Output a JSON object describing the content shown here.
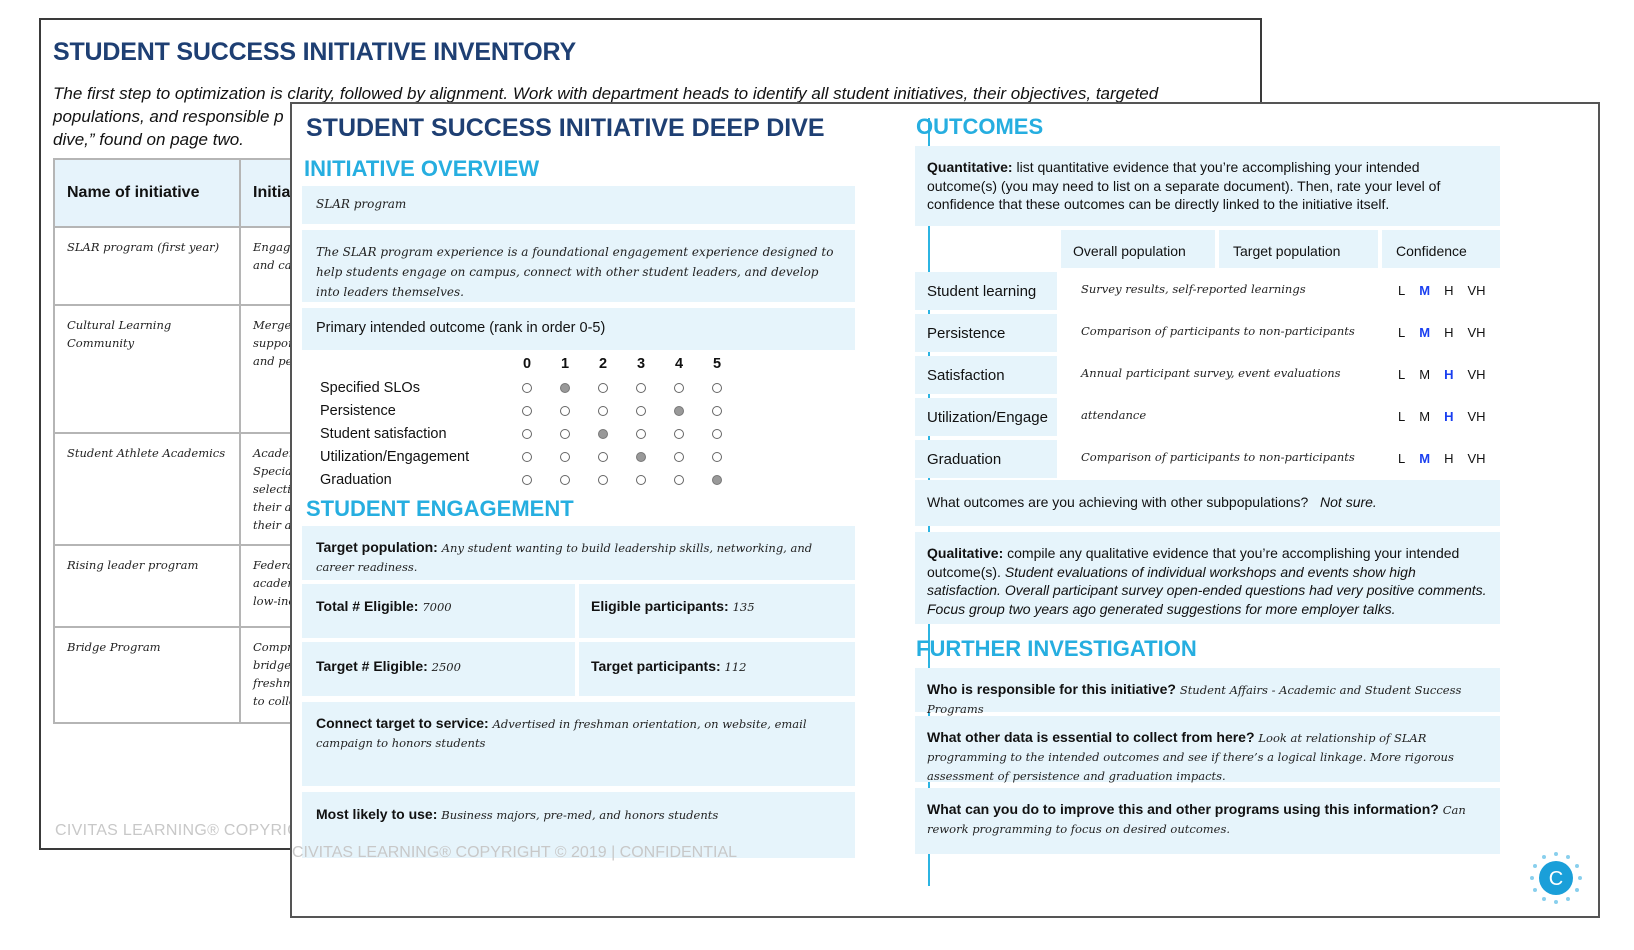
{
  "inventory": {
    "title": "STUDENT SUCCESS INITIATIVE INVENTORY",
    "intro": "The first step to optimization is clarity, followed by alignment. Work with department heads to identify all student initiatives, their objectives, targeted populations, and responsible p... dive,” found on page two.",
    "intro_line1": "The first step to optimization is clarity, followed by alignment. Work with department heads to identify all student initiatives, their objectives, targeted",
    "intro_line2": "populations, and responsible p",
    "intro_line3": "dive,” found on page two.",
    "columns": [
      "Name of initiative",
      "Initiati"
    ],
    "rows": [
      {
        "name": "SLAR program (first year)",
        "desc": "Engagem\nand care"
      },
      {
        "name": "Cultural Learning Community",
        "desc": "Merge cu\nsupport t\nand peer"
      },
      {
        "name": "Student Athlete  Academics",
        "desc": "Academic\nSpecialist\nselecting\ntheir aca\ntheir aca"
      },
      {
        "name": "Rising leader program",
        "desc": "Federally\nacademic\nlow-incom"
      },
      {
        "name": "Bridge Program",
        "desc": "Comprehe\nbridge pr\nfreshmen\nto college"
      }
    ],
    "footer": "CIVITAS LEARNING® COPYRIG"
  },
  "deep_dive": {
    "title": "STUDENT SUCCESS INITIATIVE DEEP DIVE",
    "overview": {
      "heading": "INITIATIVE OVERVIEW",
      "name": "SLAR program",
      "description": "The SLAR program experience is a foundational engagement experience designed to help students engage on campus, connect with other student leaders, and develop into leaders themselves.",
      "rank_prompt": "Primary intended outcome (rank in order 0-5)",
      "rank_scale": [
        "0",
        "1",
        "2",
        "3",
        "4",
        "5"
      ],
      "rankings": [
        {
          "label": "Specified SLOs",
          "selected": 1
        },
        {
          "label": "Persistence",
          "selected": 4
        },
        {
          "label": "Student satisfaction",
          "selected": 2
        },
        {
          "label": "Utilization/Engagement",
          "selected": 3
        },
        {
          "label": "Graduation",
          "selected": 5
        }
      ]
    },
    "engagement": {
      "heading": "STUDENT ENGAGEMENT",
      "target_population_label": "Target population:",
      "target_population": "Any student wanting to build leadership skills, networking, and career readiness.",
      "total_eligible_label": "Total # Eligible:",
      "total_eligible": "7000",
      "eligible_participants_label": "Eligible participants:",
      "eligible_participants": "135",
      "target_eligible_label": "Target # Eligible:",
      "target_eligible": "2500",
      "target_participants_label": "Target participants:",
      "target_participants": "112",
      "connect_label": "Connect target to service:",
      "connect": "Advertised in freshman orientation, on website, email campaign to honors students",
      "likely_label": "Most likely to use:",
      "likely": "Business majors, pre-med, and honors students"
    },
    "outcomes": {
      "heading": "OUTCOMES",
      "quant_label": "Quantitative:",
      "quant_text": "list quantitative evidence that you’re accomplishing your intended outcome(s) (you may need to list on a separate document). Then, rate your level of confidence that these outcomes can be directly linked to the initiative itself.",
      "columns": [
        "Overall population",
        "Target population",
        "Confidence"
      ],
      "confidence_levels": [
        "L",
        "M",
        "H",
        "VH"
      ],
      "rows": [
        {
          "label": "Student learning",
          "evidence": "Survey results, self-reported learnings",
          "confidence": "M"
        },
        {
          "label": "Persistence",
          "evidence": "Comparison of participants to non-participants",
          "confidence": "M"
        },
        {
          "label": "Satisfaction",
          "evidence": "Annual participant survey, event evaluations",
          "confidence": "H"
        },
        {
          "label": "Utilization/Engage",
          "evidence": "attendance",
          "confidence": "H"
        },
        {
          "label": "Graduation",
          "evidence": "Comparison of participants to non-participants",
          "confidence": "M"
        }
      ],
      "subpop_question": "What outcomes are you achieving with other subpopulations?",
      "subpop_answer": "Not sure.",
      "qual_label": "Qualitative:",
      "qual_prompt": "compile any qualitative evidence that you’re accomplishing your intended outcome(s).",
      "qual_answer": "Student evaluations of individual workshops and events show high satisfaction.  Overall participant survey open-ended questions had very positive comments.  Focus group two years ago generated suggestions for more employer talks."
    },
    "investigation": {
      "heading": "FURTHER INVESTIGATION",
      "items": [
        {
          "q": "Who is responsible for this  initiative?",
          "a": "Student Affairs - Academic and Student Success Programs"
        },
        {
          "q": "What other data is essential to collect from here?",
          "a": "Look at relationship of SLAR programming to the intended outcomes and see if there’s a logical linkage.  More rigorous assessment of persistence and graduation impacts."
        },
        {
          "q": "What can you do to improve this and other programs using this information?",
          "a": "Can rework programming to focus on desired outcomes."
        }
      ]
    },
    "footer": "CIVITAS LEARNING® COPYRIGHT © 2019  |  CONFIDENTIAL",
    "logo_letter": "C",
    "colors": {
      "navy": "#1e3f73",
      "accent": "#26aee0",
      "panel": "#e6f4fb",
      "selected": "#1a3ff0"
    }
  }
}
